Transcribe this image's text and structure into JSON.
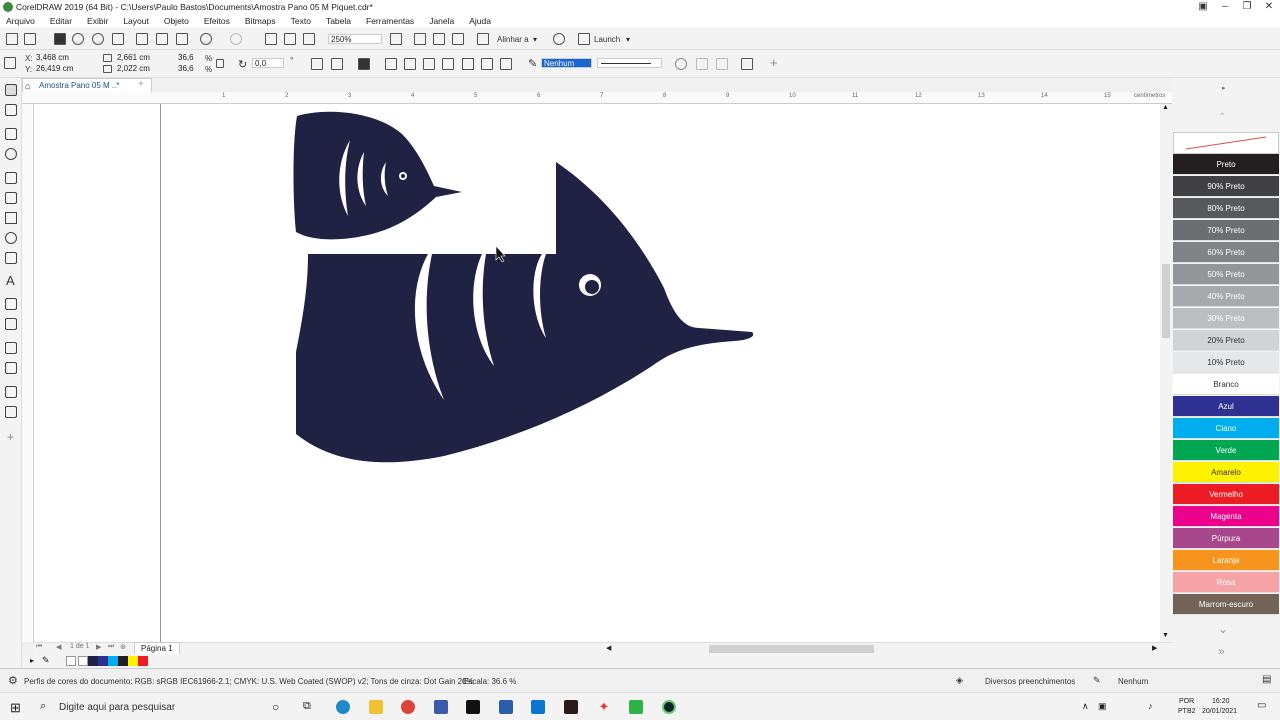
{
  "window": {
    "title": "CorelDRAW 2019 (64 Bit) - C:\\Users\\Paulo Bastos\\Documents\\Amostra Pano 05 M Piquet.cdr*"
  },
  "menu": [
    "Arquivo",
    "Editar",
    "Exibir",
    "Layout",
    "Objeto",
    "Efeitos",
    "Bitmaps",
    "Texto",
    "Tabela",
    "Ferramentas",
    "Janela",
    "Ajuda"
  ],
  "toolbar": {
    "zoom": "250%",
    "align_label": "Alinhar a",
    "launch_label": "Launch"
  },
  "property_bar": {
    "x_label": "X:",
    "x_value": "3,468 cm",
    "y_label": "Y:",
    "y_value": "26,419 cm",
    "w_value": "2,661 cm",
    "h_value": "2,022 cm",
    "sx_value": "36,6",
    "sy_value": "36,6",
    "pct": "%",
    "angle_value": "0,0",
    "outline_fill": "Nenhum"
  },
  "document": {
    "tab_label": "Amostra Pano 05 M ..*",
    "fish_color": "#1f2242"
  },
  "ruler": {
    "h_ticks": [
      "1",
      "2",
      "3",
      "4",
      "5",
      "6",
      "7",
      "8",
      "9",
      "10",
      "11",
      "12",
      "13",
      "14",
      "15"
    ],
    "unit": "centímetros"
  },
  "page_nav": {
    "counter": "1 de 1",
    "page_label": "Página 1"
  },
  "palette": [
    {
      "name": "Preto",
      "color": "#231f20",
      "fg": "#fff"
    },
    {
      "name": "90% Preto",
      "color": "#414042",
      "fg": "#fff"
    },
    {
      "name": "80% Preto",
      "color": "#58595b",
      "fg": "#fff"
    },
    {
      "name": "70% Preto",
      "color": "#6d6e71",
      "fg": "#fff"
    },
    {
      "name": "60% Preto",
      "color": "#808285",
      "fg": "#fff"
    },
    {
      "name": "50% Preto",
      "color": "#939598",
      "fg": "#fff"
    },
    {
      "name": "40% Preto",
      "color": "#a7a9ac",
      "fg": "#fff"
    },
    {
      "name": "30% Preto",
      "color": "#bcbec0",
      "fg": "#fff"
    },
    {
      "name": "20% Preto",
      "color": "#d1d3d4",
      "fg": "#333"
    },
    {
      "name": "10% Preto",
      "color": "#e6e7e8",
      "fg": "#333"
    },
    {
      "name": "Branco",
      "color": "#ffffff",
      "fg": "#333"
    },
    {
      "name": "Azul",
      "color": "#2e3192",
      "fg": "#fff"
    },
    {
      "name": "Ciano",
      "color": "#00aeef",
      "fg": "#fff"
    },
    {
      "name": "Verde",
      "color": "#00a651",
      "fg": "#fff"
    },
    {
      "name": "Amarelo",
      "color": "#fff200",
      "fg": "#333"
    },
    {
      "name": "Vermelho",
      "color": "#ed1c24",
      "fg": "#fff"
    },
    {
      "name": "Magenta",
      "color": "#ec008c",
      "fg": "#fff"
    },
    {
      "name": "Púrpura",
      "color": "#a8478c",
      "fg": "#fff"
    },
    {
      "name": "Laranja",
      "color": "#f7941d",
      "fg": "#fff"
    },
    {
      "name": "Rosa",
      "color": "#f5a3a6",
      "fg": "#fff"
    },
    {
      "name": "Marrom-escuro",
      "color": "#736357",
      "fg": "#fff"
    }
  ],
  "status": {
    "color_profile": "Perfis de cores do documento: RGB: sRGB IEC61966-2.1; CMYK: U.S. Web Coated (SWOP) v2; Tons de cinza: Dot Gain 20%",
    "scale": "Escala: 36.6 %",
    "fill": "Diversos preenchimentos",
    "outline": "Nenhum"
  },
  "taskbar": {
    "search_placeholder": "Digite aqui para pesquisar",
    "lang1": "POR",
    "lang2": "PTB2",
    "time": "16:20",
    "date": "20/01/2021"
  }
}
